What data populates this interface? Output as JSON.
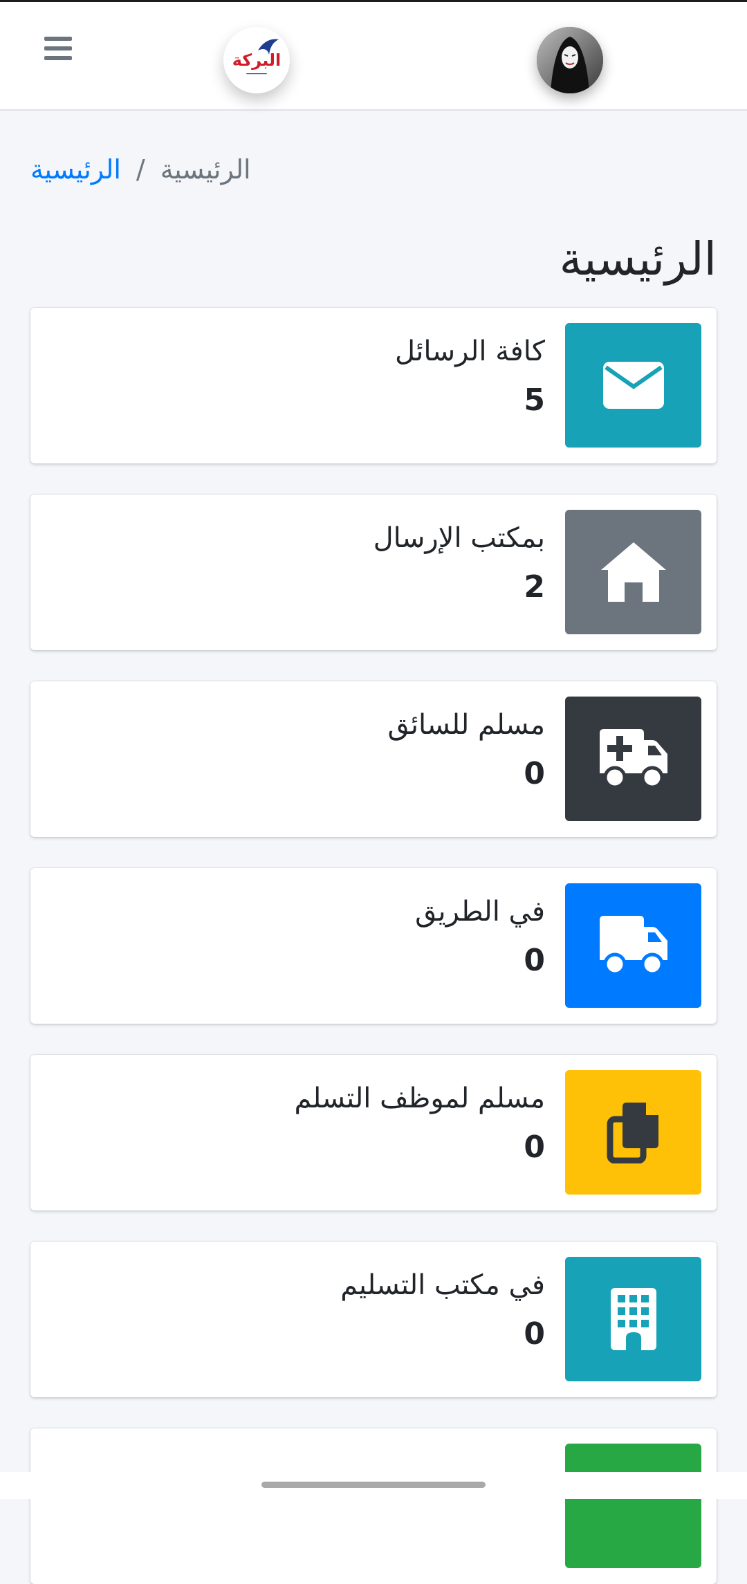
{
  "colors": {
    "info": "#17a2b8",
    "secondary": "#6c757d",
    "dark": "#343a40",
    "primary": "#007bff",
    "warning": "#ffc107",
    "success": "#28a745",
    "link": "#007bff"
  },
  "header": {
    "menu_icon": "hamburger-icon",
    "logo_text": "البركة",
    "avatar_icon": "user-avatar"
  },
  "breadcrumb": {
    "link": "الرئيسية",
    "separator": "/",
    "current": "الرئيسية"
  },
  "page": {
    "title": "الرئيسية"
  },
  "cards": [
    {
      "label": "كافة الرسائل",
      "count": "5",
      "icon": "envelope-icon",
      "color": "#17a2b8"
    },
    {
      "label": "بمكتب الإرسال",
      "count": "2",
      "icon": "home-icon",
      "color": "#6c757d"
    },
    {
      "label": "مسلم للسائق",
      "count": "0",
      "icon": "ambulance-icon",
      "color": "#343a40"
    },
    {
      "label": "في الطريق",
      "count": "0",
      "icon": "truck-icon",
      "color": "#007bff"
    },
    {
      "label": "مسلم لموظف التسلم",
      "count": "0",
      "icon": "copy-icon",
      "color": "#ffc107"
    },
    {
      "label": "في مكتب التسليم",
      "count": "0",
      "icon": "building-icon",
      "color": "#17a2b8"
    },
    {
      "icon": "box-icon",
      "color": "#28a745"
    }
  ]
}
